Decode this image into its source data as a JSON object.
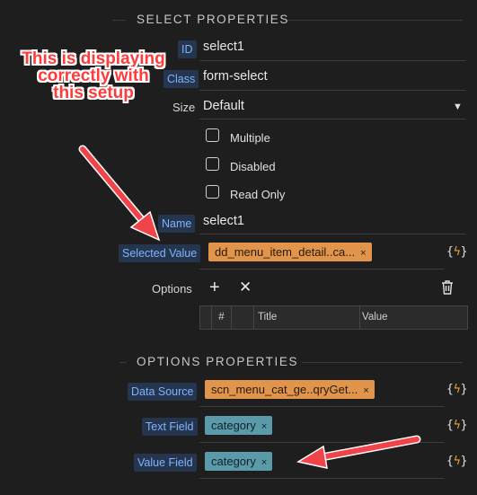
{
  "select_properties": {
    "title": "SELECT PROPERTIES",
    "id_label": "ID",
    "id_value": "select1",
    "class_label": "Class",
    "class_value": "form-select",
    "size_label": "Size",
    "size_value": "Default",
    "checkboxes": [
      {
        "label": "Multiple",
        "checked": false
      },
      {
        "label": "Disabled",
        "checked": false
      },
      {
        "label": "Read Only",
        "checked": false
      }
    ],
    "name_label": "Name",
    "name_value": "select1",
    "selected_value_label": "Selected Value",
    "selected_value_tag": "dd_menu_item_detail..ca...",
    "options_label": "Options",
    "table_headers": [
      "#",
      "Title",
      "Value"
    ]
  },
  "options_properties": {
    "title": "OPTIONS PROPERTIES",
    "data_source_label": "Data Source",
    "data_source_tag": "scn_menu_cat_ge..qryGet...",
    "text_field_label": "Text Field",
    "text_field_tag": "category",
    "value_field_label": "Value Field",
    "value_field_tag": "category"
  },
  "dynamic_button": "{ }",
  "tag_remove_glyph": "×",
  "annotation_text": "This is displaying correctly with this setup",
  "colors": {
    "background": "#1e1e1e",
    "label_blue": "#7fb4ff",
    "tag_orange": "#e0944c",
    "tag_teal": "#5b9aa8",
    "arrow_red": "#f0434a"
  }
}
